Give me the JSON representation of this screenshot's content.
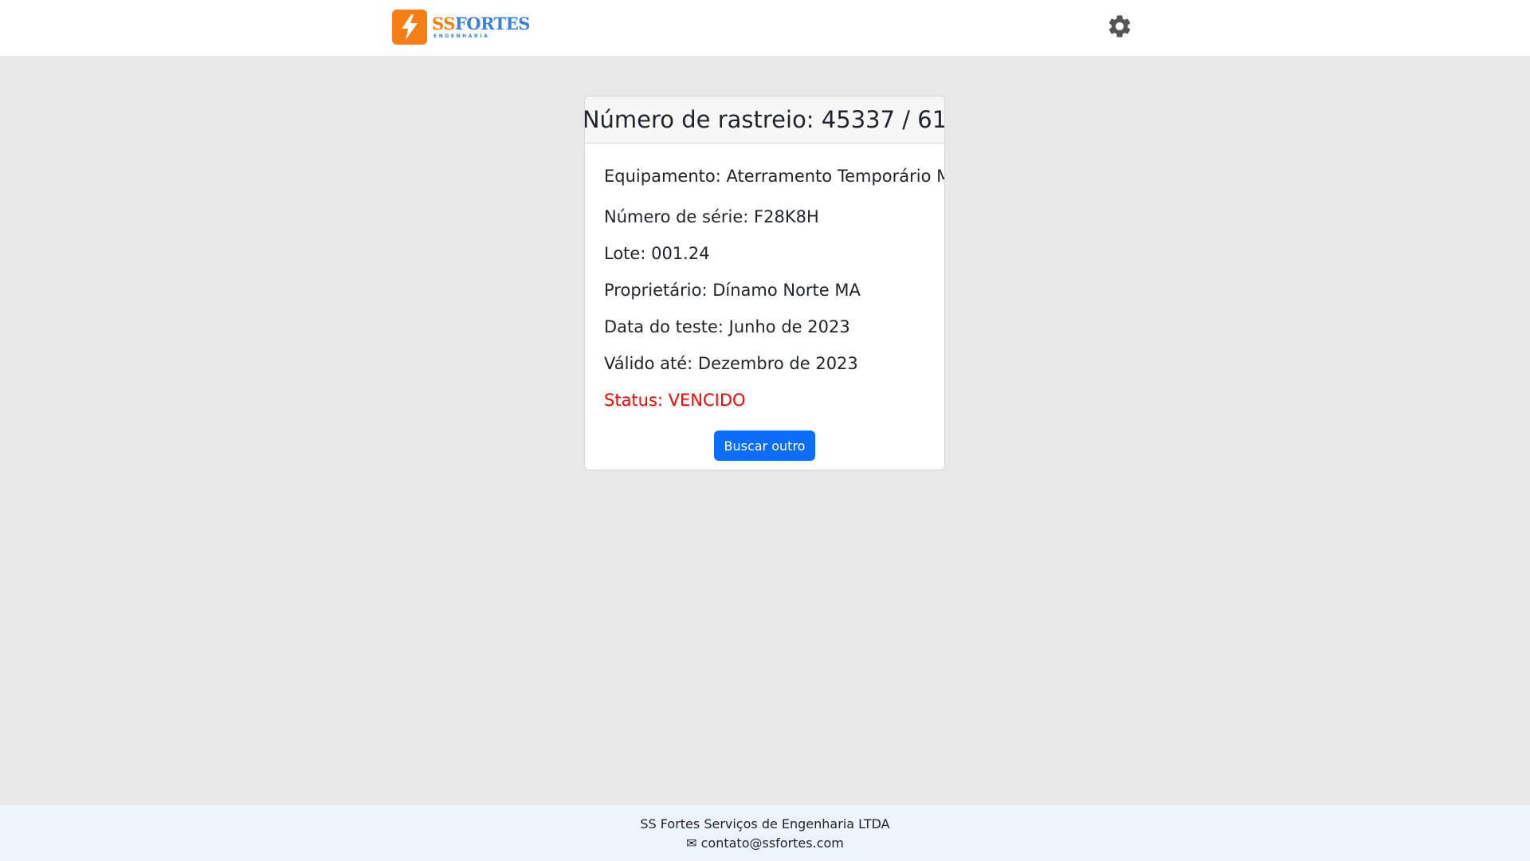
{
  "header": {
    "logo": {
      "brand_ss": "SS",
      "brand_fortes": "FORTES",
      "subtitle": "ENGENHARIA",
      "mark_icon": "lightning-bolt-icon"
    },
    "settings_icon": "gear-icon"
  },
  "card": {
    "title": "Número de rastreio: 45337 / 61",
    "fields": {
      "equipamento": "Equipamento: Aterramento Temporário MT",
      "numero_serie": "Número de série: F28K8H",
      "lote": "Lote: 001.24",
      "proprietario": "Proprietário: Dínamo Norte MA",
      "data_teste": "Data do teste: Junho de 2023",
      "valido_ate": "Válido até: Dezembro de 2023",
      "status": "Status: VENCIDO"
    },
    "button_label": "Buscar outro"
  },
  "footer": {
    "company": "SS Fortes Serviços de Engenharia LTDA",
    "email_icon": "envelope-icon",
    "email": "✉ contato@ssfortes.com"
  },
  "colors": {
    "background": "#e8e8e8",
    "brand_orange": "#f47f16",
    "brand_blue": "#3d82d8",
    "primary_button": "#0d6efd",
    "status_expired": "#ff0000",
    "footer_bg": "#eef4fb"
  }
}
